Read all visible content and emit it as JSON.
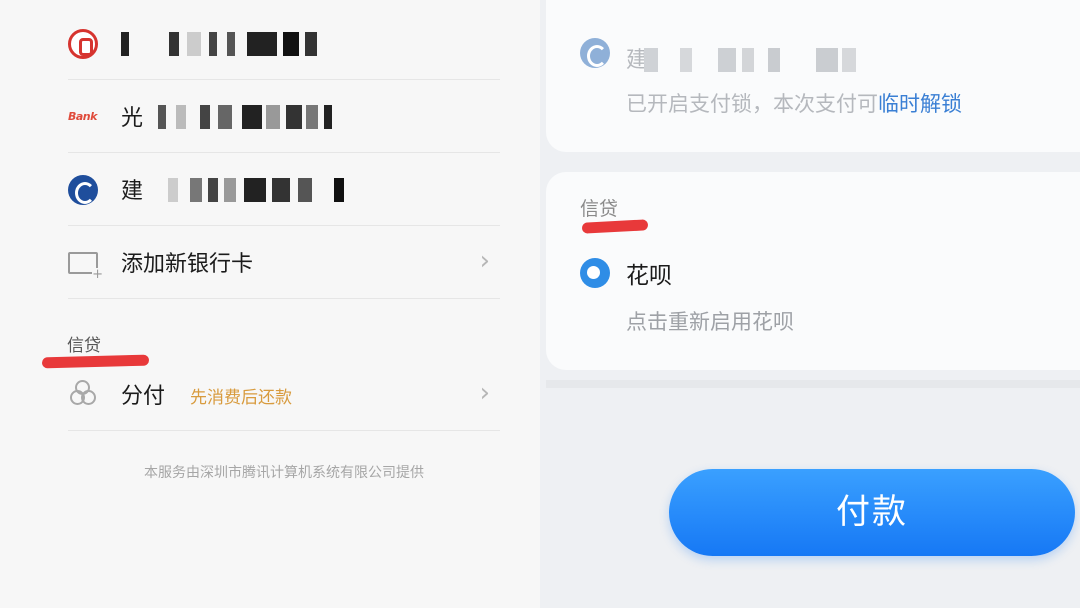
{
  "left": {
    "cards": [
      {
        "icon": "cgb-bank-icon",
        "name": ""
      },
      {
        "icon": "bank-logo-icon",
        "name": "光",
        "logo_text": "Bank"
      },
      {
        "icon": "ccb-bank-icon",
        "name": "建"
      }
    ],
    "add_card_label": "添加新银行卡",
    "credit_section_title": "信贷",
    "installment": {
      "label": "分付",
      "tag": "先消费后还款"
    },
    "footer": "本服务由深圳市腾讯计算机系统有限公司提供"
  },
  "right": {
    "bank": {
      "name": "建",
      "icon": "ccb-bank-icon"
    },
    "lock_note": "已开启支付锁，本次支付可",
    "unlock_link": "临时解锁",
    "credit_section_title": "信贷",
    "huabei": {
      "name": "花呗",
      "desc": "点击重新启用花呗",
      "icon": "huabei-icon"
    },
    "pay_button": "付款"
  },
  "colors": {
    "accent_blue": "#1678f5",
    "link_blue": "#3a7fd4",
    "annotation_red": "#e8393a",
    "tag_orange": "#d89b3e"
  }
}
